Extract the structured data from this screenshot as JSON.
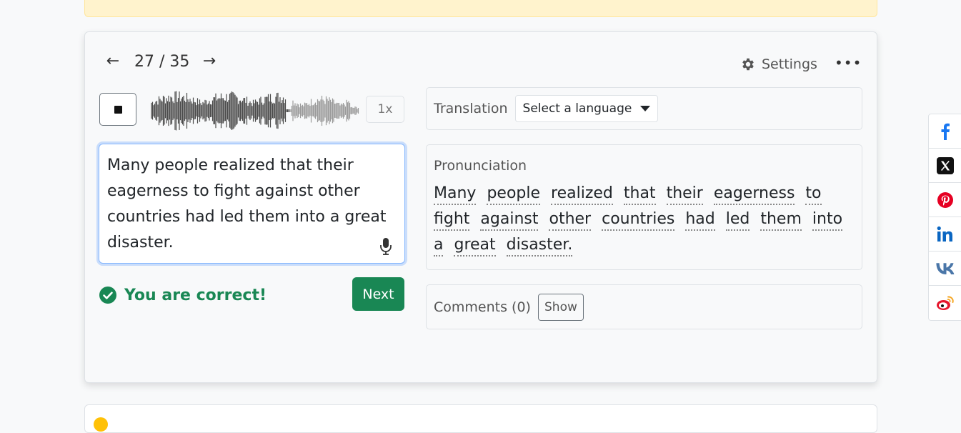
{
  "player": {
    "prev_label": "←",
    "counter": "27 / 35",
    "next_label": "→",
    "speed": "1x"
  },
  "toolbar": {
    "settings_label": "Settings",
    "more_label": "•••"
  },
  "answer": {
    "text": "Many people realized that their eagerness to fight against other countries had led them into a great disaster."
  },
  "result": {
    "message": "You are correct!",
    "next_button": "Next"
  },
  "translation": {
    "label": "Translation",
    "select_value": "Select a language"
  },
  "pronunciation": {
    "label": "Pronunciation",
    "words": [
      "Many",
      "people",
      "realized",
      "that",
      "their",
      "eagerness",
      "to",
      "fight",
      "against",
      "other",
      "countries",
      "had",
      "led",
      "them",
      "into",
      "a",
      "great",
      "disaster."
    ]
  },
  "comments": {
    "label": "Comments (0)",
    "show_button": "Show"
  },
  "share": {
    "items": [
      "facebook-icon",
      "x-icon",
      "pinterest-icon",
      "linkedin-icon",
      "vk-icon",
      "weibo-icon"
    ]
  },
  "colors": {
    "success": "#198754",
    "focus_border": "#86b7fe",
    "banner": "#fff3cd",
    "facebook": "#1877f2",
    "pinterest": "#e60023",
    "linkedin": "#0a66c2",
    "vk": "#4a76a8",
    "weibo": "#e6162d"
  }
}
